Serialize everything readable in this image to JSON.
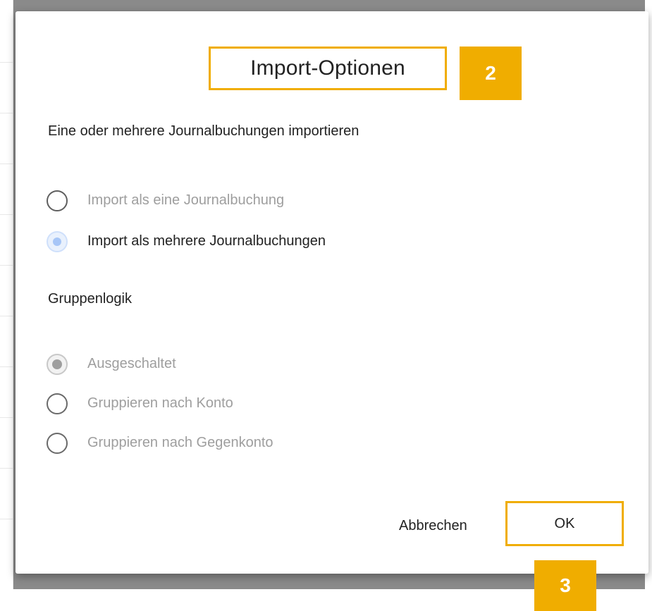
{
  "dialog": {
    "title": "Import-Optionen",
    "description": "Eine oder mehrere Journalbuchungen importieren",
    "import_options": [
      {
        "label": "Import als eine Journalbuchung",
        "selected": false
      },
      {
        "label": "Import als mehrere Journalbuchungen",
        "selected": true
      }
    ],
    "group_heading": "Gruppenlogik",
    "group_options": [
      {
        "label": "Ausgeschaltet",
        "selected": true
      },
      {
        "label": "Gruppieren nach Konto",
        "selected": false
      },
      {
        "label": "Gruppieren nach Gegenkonto",
        "selected": false
      }
    ],
    "buttons": {
      "cancel": "Abbrechen",
      "ok": "OK"
    }
  },
  "callouts": {
    "title_marker": "2",
    "ok_marker": "3"
  },
  "colors": {
    "highlight": "#f0ad00",
    "selected_radio": "#a7c6f7",
    "disabled_text": "#9e9e9e"
  }
}
